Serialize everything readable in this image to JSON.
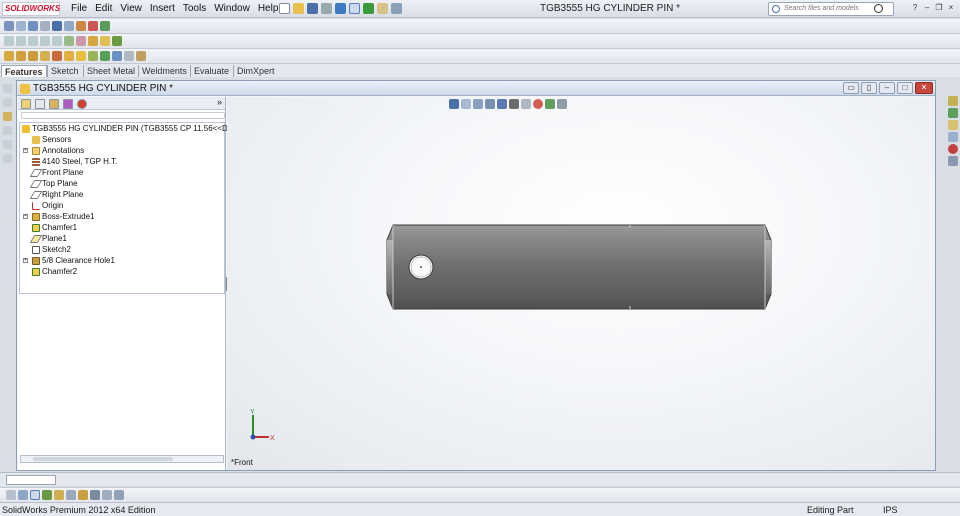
{
  "app": {
    "logo_text": "SOLIDWORKS",
    "document_title": "TGB3555 HG CYLINDER PIN *",
    "search_placeholder": "Search files and models"
  },
  "menu": [
    "File",
    "Edit",
    "View",
    "Insert",
    "Tools",
    "Window",
    "Help"
  ],
  "command_tabs": [
    "Features",
    "Sketch",
    "Sheet Metal",
    "Weldments",
    "Evaluate",
    "DimXpert"
  ],
  "active_tab": "Features",
  "doc_window": {
    "title": "TGB3555 HG CYLINDER PIN *"
  },
  "feature_tree": {
    "root": "TGB3555 HG CYLINDER PIN  (TGB3555 CP 11.56<<Default>",
    "items": [
      {
        "label": "Sensors",
        "icon": "sensors-icon",
        "expandable": false
      },
      {
        "label": "Annotations",
        "icon": "annotations-icon",
        "expandable": true
      },
      {
        "label": "4140 Steel, TGP H.T.",
        "icon": "material-icon",
        "expandable": false
      },
      {
        "label": "Front Plane",
        "icon": "plane-icon",
        "expandable": false
      },
      {
        "label": "Top Plane",
        "icon": "plane-icon",
        "expandable": false
      },
      {
        "label": "Right Plane",
        "icon": "plane-icon",
        "expandable": false
      },
      {
        "label": "Origin",
        "icon": "origin-icon",
        "expandable": false
      },
      {
        "label": "Boss-Extrude1",
        "icon": "extrude-icon",
        "expandable": true
      },
      {
        "label": "Chamfer1",
        "icon": "chamfer-icon",
        "expandable": false
      },
      {
        "label": "Plane1",
        "icon": "plane-icon",
        "expandable": false
      },
      {
        "label": "Sketch2",
        "icon": "sketch-icon",
        "expandable": false
      },
      {
        "label": "5/8 Clearance Hole1",
        "icon": "hole-icon",
        "expandable": true
      },
      {
        "label": "Chamfer2",
        "icon": "chamfer-icon",
        "expandable": false
      }
    ]
  },
  "graphics": {
    "view_label": "*Front",
    "triad": {
      "y": "Y",
      "x": "X"
    }
  },
  "status_bar": {
    "product": "SolidWorks Premium 2012 x64 Edition",
    "mode": "Editing Part",
    "units": "IPS"
  },
  "colors": {
    "part_gray": "#7a7a7a",
    "logo_red": "#c8102e",
    "tree_border": "#b9c6db"
  }
}
